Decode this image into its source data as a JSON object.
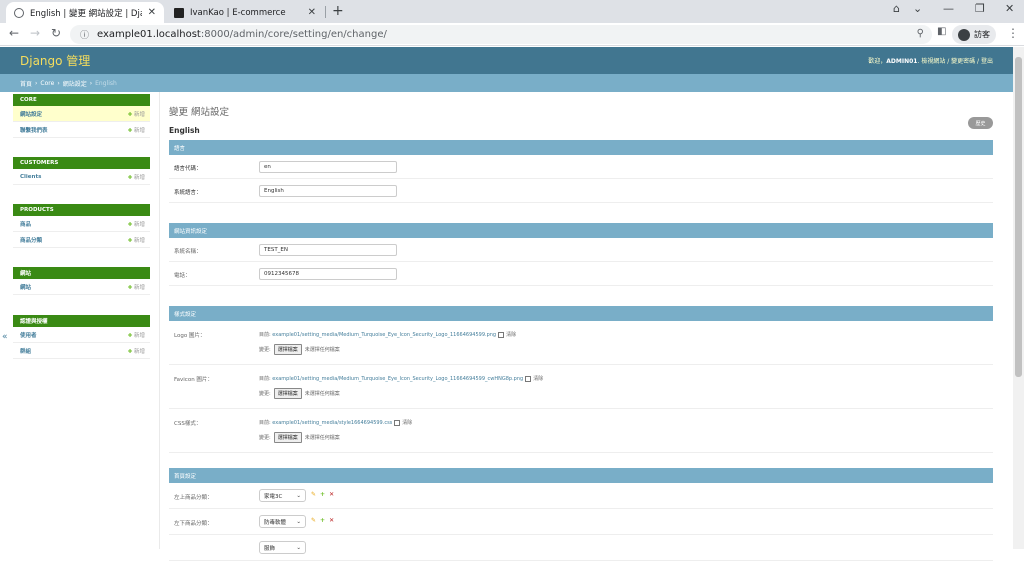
{
  "browser": {
    "tabs": [
      {
        "title": "English | 變更 網站設定 | Django",
        "close": "✕"
      },
      {
        "title": "IvanKao | E-commerce",
        "close": "✕"
      }
    ],
    "new_tab": "+",
    "url_host": "example01.localhost",
    "url_rest": ":8000/admin/core/setting/en/change/",
    "profile_label": "訪客"
  },
  "header": {
    "brand": "Django 管理",
    "welcome": "歡迎，",
    "username": "ADMIN01",
    "links": "檢視網站 / 變更密碼 / 登出"
  },
  "breadcrumbs": {
    "home": "首頁",
    "app": "Core",
    "model": "網站設定",
    "current": "English"
  },
  "sidebar": {
    "add_label": "新增",
    "modules": [
      {
        "caption": "CORE",
        "items": [
          "網站設定",
          "聯繫我們表"
        ]
      },
      {
        "caption": "CUSTOMERS",
        "items": [
          "Clients"
        ]
      },
      {
        "caption": "PRODUCTS",
        "items": [
          "商品",
          "商品分類"
        ]
      },
      {
        "caption": "網站",
        "items": [
          "網站"
        ]
      },
      {
        "caption": "認證與授權",
        "items": [
          "使用者",
          "群組"
        ]
      }
    ],
    "collapse": "«"
  },
  "content": {
    "title": "變更 網站設定",
    "object_name": "English",
    "history_button": "歷史",
    "fieldsets": {
      "language": {
        "heading": "語言",
        "code_label": "語言代碼：",
        "code_value": "en",
        "name_label": "系統語言：",
        "name_value": "English"
      },
      "site_info": {
        "heading": "網站資訊設定",
        "sysname_label": "系統名稱：",
        "sysname_value": "TEST_EN",
        "phone_label": "電話：",
        "phone_value": "0912345678"
      },
      "style": {
        "heading": "樣式設定",
        "current_prefix": "目前:",
        "clear_label": "清除",
        "change_prefix": "變更:",
        "choose_file": "選擇檔案",
        "no_file": "未選擇任何檔案",
        "logo_label": "Logo 圖片：",
        "logo_path": "example01/setting_media/Medium_Turquoise_Eye_Icon_Security_Logo_11664694599.png",
        "favicon_label": "Favicon 圖片：",
        "favicon_path": "example01/setting_media/Medium_Turquoise_Eye_Icon_Security_Logo_11664694599_cwHNG8p.png",
        "css_label": "CSS樣式：",
        "css_path": "example01/setting_media/style1664694599.css"
      },
      "homepage": {
        "heading": "首頁設定",
        "top_left_label": "左上商品分類：",
        "top_left_value": "家電3C",
        "bottom_left_label": "左下商品分類：",
        "bottom_left_value": "防毒軟體",
        "third_value": "服飾"
      }
    }
  }
}
